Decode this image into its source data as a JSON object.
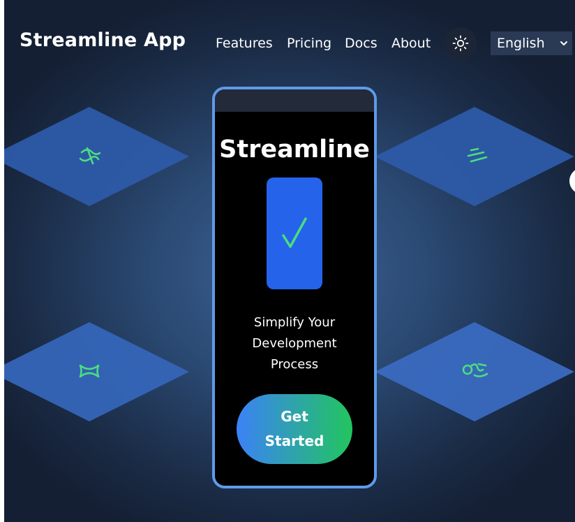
{
  "header": {
    "brand": "Streamline App",
    "nav": [
      "Features",
      "Pricing",
      "Docs",
      "About"
    ],
    "theme_icon": "sun-icon",
    "language": "English",
    "language_icon": "chevron-down-icon"
  },
  "hero": {
    "title": "Streamline",
    "check_icon": "check-icon",
    "tagline_lines": [
      "Simplify Your",
      "Development",
      "Process"
    ],
    "cta_lines": [
      "Get",
      "Started"
    ]
  },
  "feature_tiles": [
    {
      "icon": "dollar-icon"
    },
    {
      "icon": "lines-icon"
    },
    {
      "icon": "bowtie-icon"
    },
    {
      "icon": "glyph-icon"
    }
  ],
  "colors": {
    "accent_blue": "#2563eb",
    "accent_green": "#22c55e",
    "phone_border": "#5f9ae8",
    "tile_blue": "#3a6ac0",
    "icon_green": "#4ade80"
  }
}
